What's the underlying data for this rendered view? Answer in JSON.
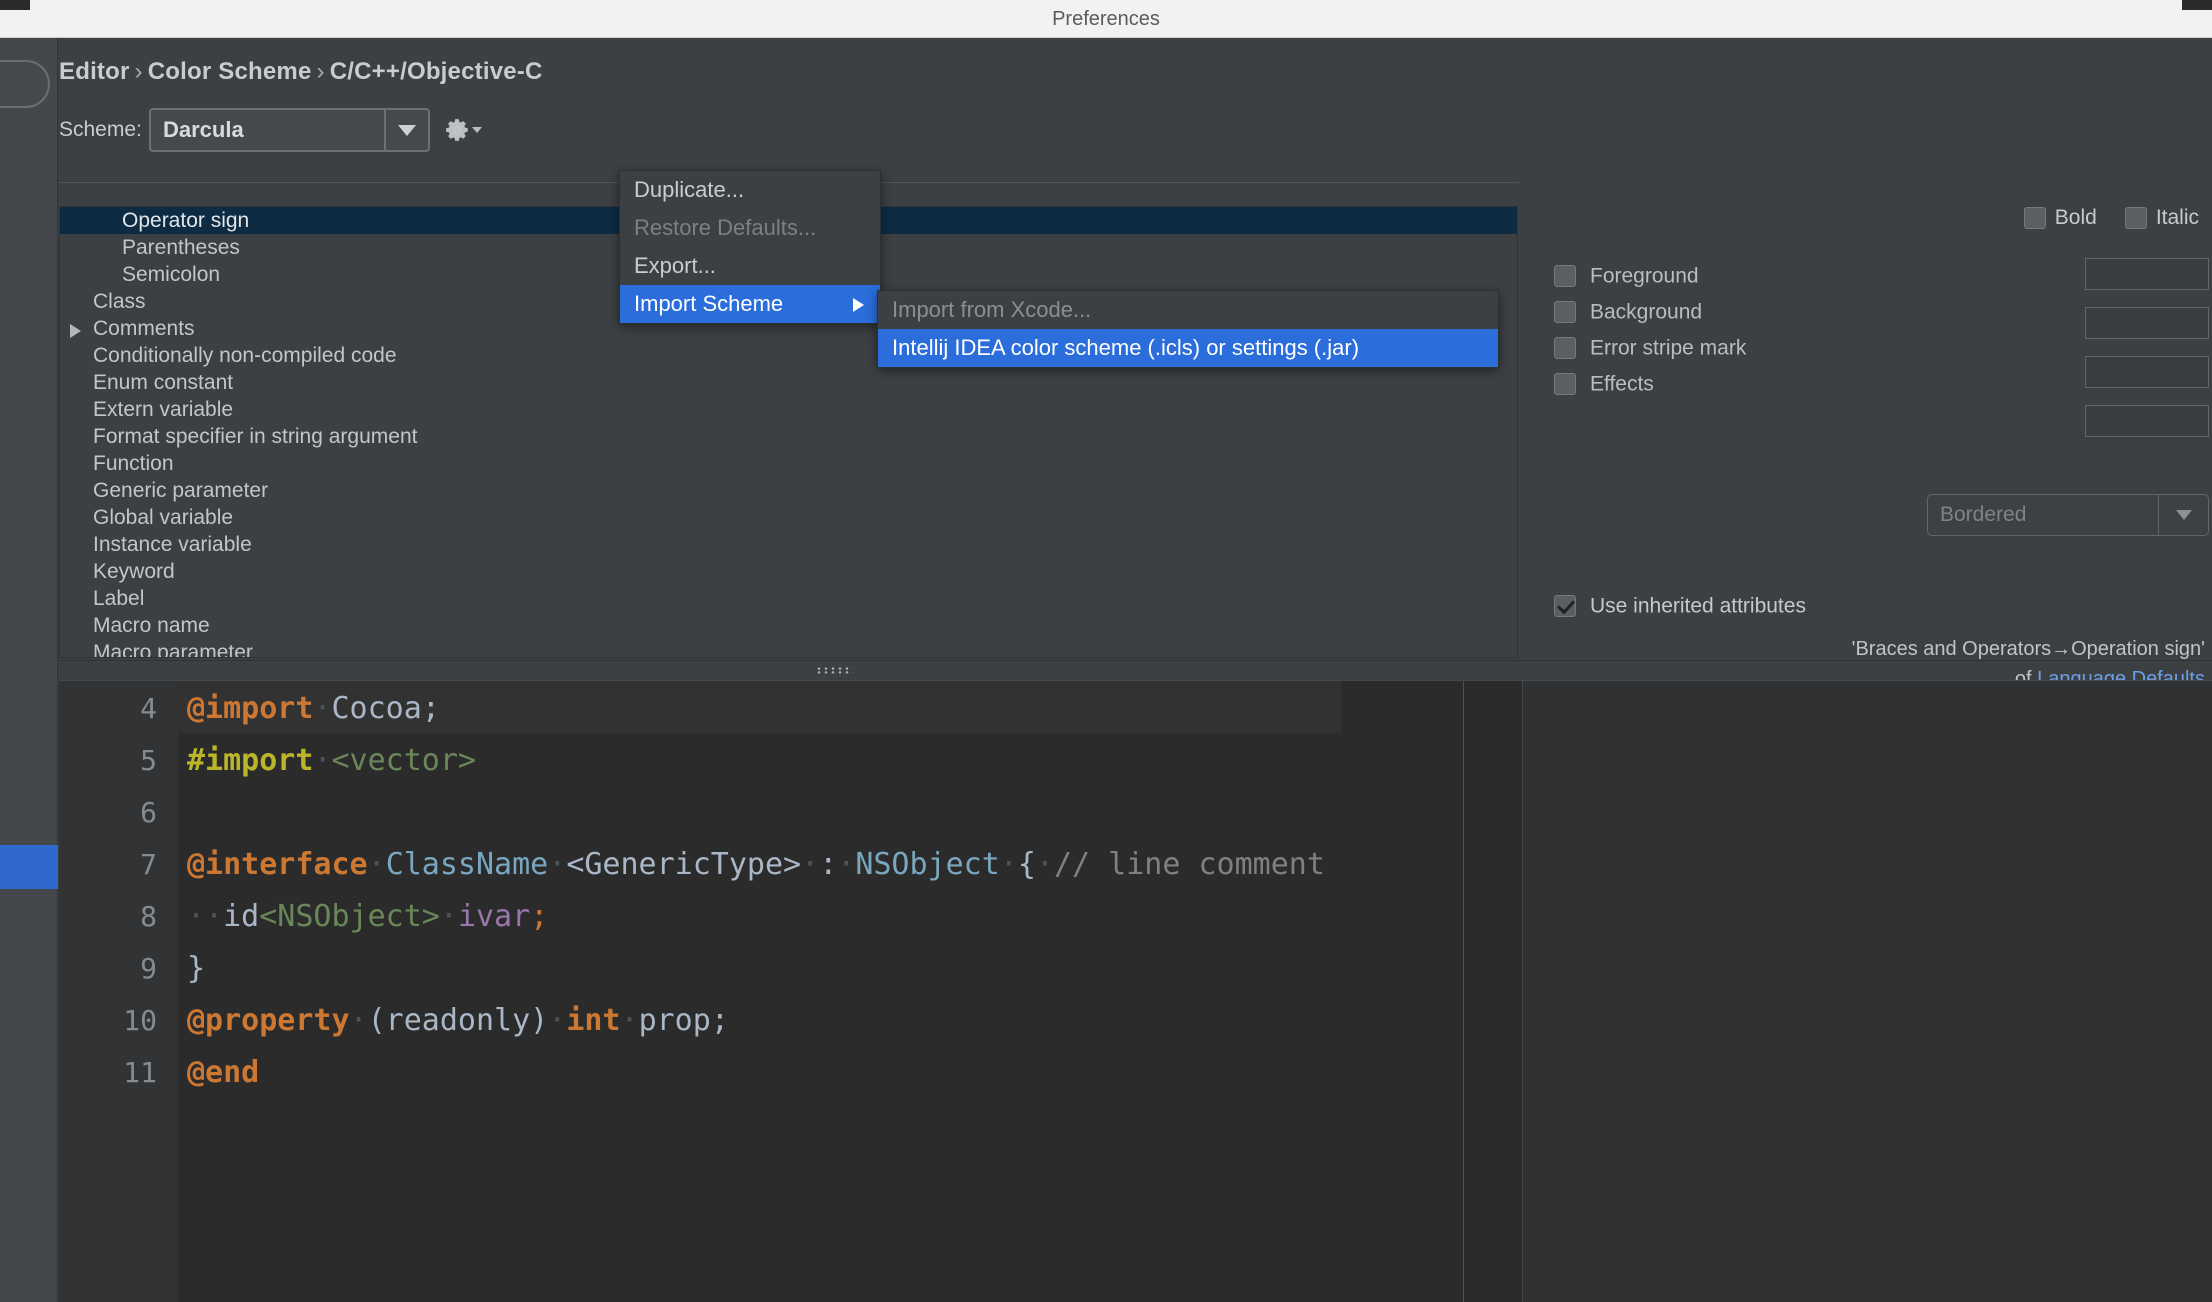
{
  "window": {
    "title": "Preferences"
  },
  "breadcrumb": {
    "items": [
      "Editor",
      "Color Scheme",
      "C/C++/Objective-C"
    ],
    "separator": "›"
  },
  "scheme": {
    "label": "Scheme:",
    "value": "Darcula",
    "gear_icon": "gear-icon"
  },
  "gear_menu": {
    "items": [
      {
        "label": "Duplicate...",
        "enabled": true,
        "selected": false,
        "submenu": false
      },
      {
        "label": "Restore Defaults...",
        "enabled": false,
        "selected": false,
        "submenu": false
      },
      {
        "label": "Export...",
        "enabled": true,
        "selected": false,
        "submenu": false
      },
      {
        "label": "Import Scheme",
        "enabled": true,
        "selected": true,
        "submenu": true
      }
    ],
    "submenu": {
      "items": [
        {
          "label": "Import from Xcode...",
          "enabled": false,
          "selected": false
        },
        {
          "label": "Intellij IDEA color scheme (.icls) or settings (.jar)",
          "enabled": true,
          "selected": true
        }
      ]
    }
  },
  "tree": {
    "items": [
      {
        "label": "Operator sign",
        "depth": 2,
        "arrow": false,
        "selected": true
      },
      {
        "label": "Parentheses",
        "depth": 2,
        "arrow": false,
        "selected": false
      },
      {
        "label": "Semicolon",
        "depth": 2,
        "arrow": false,
        "selected": false
      },
      {
        "label": "Class",
        "depth": 1,
        "arrow": false,
        "selected": false
      },
      {
        "label": "Comments",
        "depth": 1,
        "arrow": true,
        "selected": false
      },
      {
        "label": "Conditionally non-compiled code",
        "depth": 1,
        "arrow": false,
        "selected": false
      },
      {
        "label": "Enum constant",
        "depth": 1,
        "arrow": false,
        "selected": false
      },
      {
        "label": "Extern variable",
        "depth": 1,
        "arrow": false,
        "selected": false
      },
      {
        "label": "Format specifier in string argument",
        "depth": 1,
        "arrow": false,
        "selected": false
      },
      {
        "label": "Function",
        "depth": 1,
        "arrow": false,
        "selected": false
      },
      {
        "label": "Generic parameter",
        "depth": 1,
        "arrow": false,
        "selected": false
      },
      {
        "label": "Global variable",
        "depth": 1,
        "arrow": false,
        "selected": false
      },
      {
        "label": "Instance variable",
        "depth": 1,
        "arrow": false,
        "selected": false
      },
      {
        "label": "Keyword",
        "depth": 1,
        "arrow": false,
        "selected": false
      },
      {
        "label": "Label",
        "depth": 1,
        "arrow": false,
        "selected": false
      },
      {
        "label": "Macro name",
        "depth": 1,
        "arrow": false,
        "selected": false
      },
      {
        "label": "Macro parameter",
        "depth": 1,
        "arrow": false,
        "selected": false
      }
    ]
  },
  "attributes": {
    "bold_label": "Bold",
    "bold_checked": false,
    "italic_label": "Italic",
    "italic_checked": false,
    "rows": [
      {
        "label": "Foreground",
        "checked": false
      },
      {
        "label": "Background",
        "checked": false
      },
      {
        "label": "Error stripe mark",
        "checked": false
      },
      {
        "label": "Effects",
        "checked": false
      }
    ],
    "effects_type": "Bordered",
    "inherited_label": "Use inherited attributes",
    "inherited_checked": true,
    "inherited_source": "'Braces and Operators→Operation sign'",
    "inherited_of": "of",
    "inherited_link": "Language Defaults"
  },
  "preview": {
    "lines": [
      {
        "num": "4",
        "tokens": [
          {
            "t": "@import",
            "c": "t-kw"
          },
          {
            "t": "·",
            "c": "t-dot"
          },
          {
            "t": "Cocoa",
            "c": "t-plain"
          },
          {
            "t": ";",
            "c": "t-plain"
          }
        ]
      },
      {
        "num": "5",
        "tokens": [
          {
            "t": "#import",
            "c": "t-macro"
          },
          {
            "t": "·",
            "c": "t-dot"
          },
          {
            "t": "<vector>",
            "c": "t-str"
          }
        ]
      },
      {
        "num": "6",
        "tokens": []
      },
      {
        "num": "7",
        "tokens": [
          {
            "t": "@interface",
            "c": "t-kw"
          },
          {
            "t": "·",
            "c": "t-dot"
          },
          {
            "t": "ClassName",
            "c": "t-class"
          },
          {
            "t": "·",
            "c": "t-dot"
          },
          {
            "t": "<GenericType>",
            "c": "t-plain"
          },
          {
            "t": "·",
            "c": "t-dot"
          },
          {
            "t": ":",
            "c": "t-plain"
          },
          {
            "t": "·",
            "c": "t-dot"
          },
          {
            "t": "NSObject",
            "c": "t-class"
          },
          {
            "t": "·",
            "c": "t-dot"
          },
          {
            "t": "{",
            "c": "t-plain"
          },
          {
            "t": "·",
            "c": "t-dot"
          },
          {
            "t": "// line comment",
            "c": "t-cmt"
          }
        ]
      },
      {
        "num": "8",
        "tokens": [
          {
            "t": "··",
            "c": "t-dot"
          },
          {
            "t": "id",
            "c": "t-plain"
          },
          {
            "t": "<NSObject>",
            "c": "t-str"
          },
          {
            "t": "·",
            "c": "t-dot"
          },
          {
            "t": "ivar",
            "c": "t-ivar"
          },
          {
            "t": ";",
            "c": "t-semi"
          }
        ]
      },
      {
        "num": "9",
        "tokens": [
          {
            "t": "}",
            "c": "t-plain"
          }
        ]
      },
      {
        "num": "10",
        "tokens": [
          {
            "t": "@property",
            "c": "t-kw"
          },
          {
            "t": "·",
            "c": "t-dot"
          },
          {
            "t": "(readonly)",
            "c": "t-plain"
          },
          {
            "t": "·",
            "c": "t-dot"
          },
          {
            "t": "int",
            "c": "t-kw"
          },
          {
            "t": "·",
            "c": "t-dot"
          },
          {
            "t": "prop",
            "c": "t-plain"
          },
          {
            "t": ";",
            "c": "t-plain"
          }
        ]
      },
      {
        "num": "11",
        "tokens": [
          {
            "t": "@end",
            "c": "t-kw"
          }
        ]
      }
    ]
  },
  "colors": {
    "accent_blue": "#3069ce",
    "menu_highlight": "#2a6ddb",
    "tree_selection": "#0d2b42",
    "link": "#6f9ee8",
    "window_bg": "#3c4043",
    "editor_bg": "#2b2b2b",
    "keyword_orange": "#cc7832",
    "macro_yellow": "#bbb529",
    "string_green": "#6a8759"
  }
}
